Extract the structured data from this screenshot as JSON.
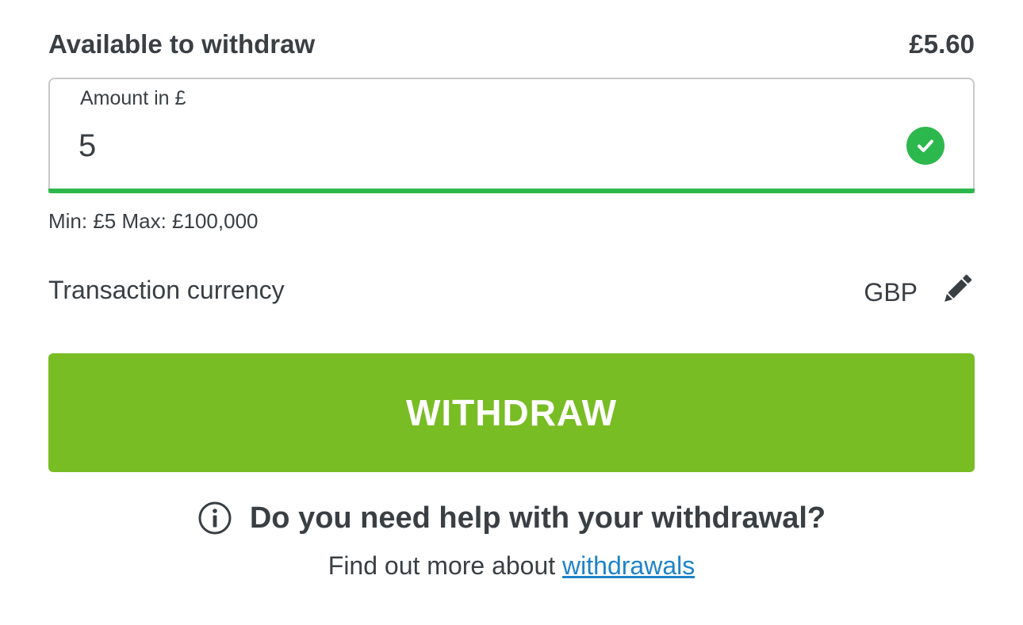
{
  "available": {
    "label": "Available to withdraw",
    "value": "£5.60"
  },
  "amount_field": {
    "label": "Amount in £",
    "value": "5",
    "status_icon": "check-circle-icon",
    "valid_color": "#2db84d"
  },
  "limits_text": "Min: £5 Max: £100,000",
  "currency": {
    "label": "Transaction currency",
    "value": "GBP",
    "edit_icon": "pencil-icon"
  },
  "withdraw_button": {
    "label": "WITHDRAW",
    "color": "#78bd24"
  },
  "help": {
    "icon": "info-icon",
    "title": "Do you need help with your withdrawal?",
    "more_prefix": "Find out more about ",
    "more_link": "withdrawals",
    "link_color": "#1e83c8"
  }
}
